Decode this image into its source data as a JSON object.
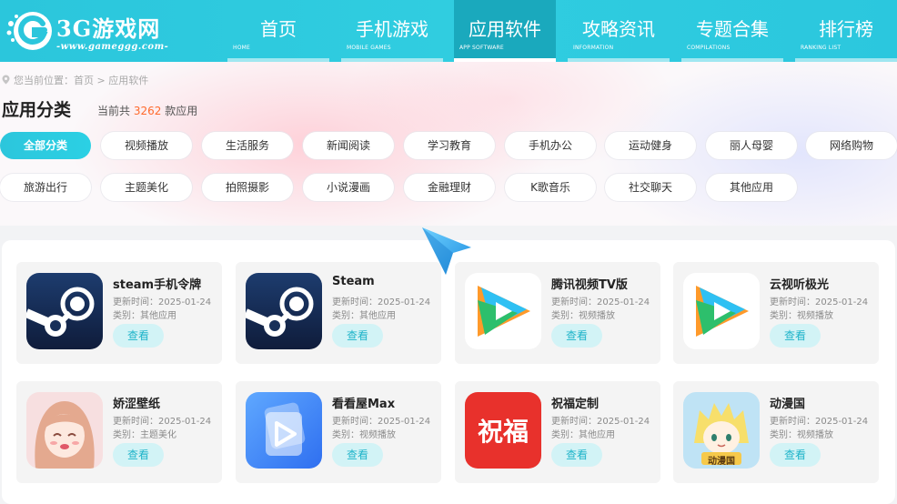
{
  "header": {
    "logo_title": "3G游戏网",
    "logo_url": "-www.gameggg.com-",
    "nav": [
      {
        "label": "首页",
        "sub": "HOME"
      },
      {
        "label": "手机游戏",
        "sub": "MOBILE GAMES"
      },
      {
        "label": "应用软件",
        "sub": "APP SOFTWARE",
        "active": true
      },
      {
        "label": "攻略资讯",
        "sub": "INFORMATION"
      },
      {
        "label": "专题合集",
        "sub": "COMPILATIONS"
      },
      {
        "label": "排行榜",
        "sub": "RANKING LIST"
      }
    ]
  },
  "breadcrumb": {
    "prefix": "您当前位置：",
    "home": "首页",
    "separator": ">",
    "current": "应用软件"
  },
  "category_section": {
    "title": "应用分类",
    "count_prefix": "当前共",
    "count": "3262",
    "count_suffix": "款应用",
    "categories": [
      "全部分类",
      "视频播放",
      "生活服务",
      "新闻阅读",
      "学习教育",
      "手机办公",
      "运动健身",
      "丽人母婴",
      "网络购物",
      "旅游出行",
      "主题美化",
      "拍照摄影",
      "小说漫画",
      "金融理财",
      "K歌音乐",
      "社交聊天",
      "其他应用"
    ],
    "active_category": "全部分类"
  },
  "apps": [
    {
      "name": "steam手机令牌",
      "date": "更新时间：2025-01-24",
      "category": "类别：其他应用",
      "icon": "steam-icon",
      "button": "查看"
    },
    {
      "name": "Steam",
      "date": "更新时间：2025-01-24",
      "category": "类别：其他应用",
      "icon": "steam-icon",
      "button": "查看"
    },
    {
      "name": "腾讯视频TV版",
      "date": "更新时间：2025-01-24",
      "category": "类别：视频播放",
      "icon": "tencent-video-icon",
      "button": "查看"
    },
    {
      "name": "云视听极光",
      "date": "更新时间：2025-01-24",
      "category": "类别：视频播放",
      "icon": "tencent-video-icon",
      "button": "查看"
    },
    {
      "name": "娇涩壁纸",
      "date": "更新时间：2025-01-24",
      "category": "类别：主题美化",
      "icon": "anime-girl-icon",
      "button": "查看"
    },
    {
      "name": "看看屋Max",
      "date": "更新时间：2025-01-24",
      "category": "类别：视频播放",
      "icon": "play-cards-icon",
      "button": "查看"
    },
    {
      "name": "祝福定制",
      "date": "更新时间：2025-01-24",
      "category": "类别：其他应用",
      "icon": "blessing-icon",
      "icon_text": "祝福",
      "button": "查看"
    },
    {
      "name": "动漫国",
      "date": "更新时间：2025-01-24",
      "category": "类别：视频播放",
      "icon": "anime-boy-icon",
      "icon_text": "动漫国",
      "button": "查看"
    }
  ],
  "colors": {
    "brand": "#2bc6dc",
    "nav_active": "#1aa9bd",
    "count_highlight": "#ff6a2c",
    "button_bg": "#d2f3f6",
    "button_text": "#1fb4c9"
  }
}
